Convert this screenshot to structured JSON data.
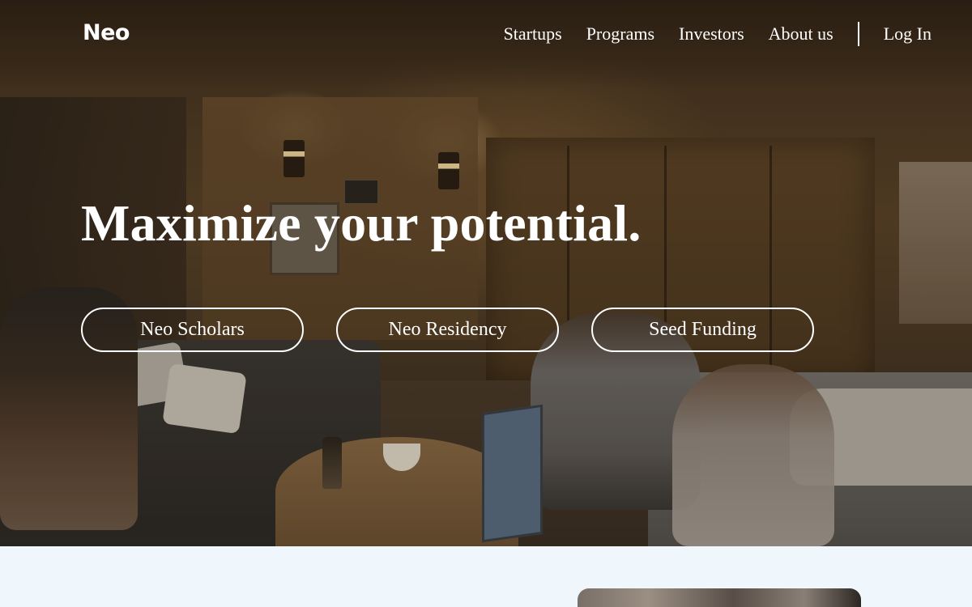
{
  "brand": {
    "logo_text": "Neo"
  },
  "nav": {
    "items": [
      {
        "label": "Startups"
      },
      {
        "label": "Programs"
      },
      {
        "label": "Investors"
      },
      {
        "label": "About us"
      }
    ],
    "login_label": "Log In"
  },
  "hero": {
    "headline": "Maximize your potential.",
    "buttons": [
      {
        "label": "Neo Scholars"
      },
      {
        "label": "Neo Residency"
      },
      {
        "label": "Seed Funding"
      }
    ]
  },
  "colors": {
    "text_on_hero": "#ffffff",
    "section_background": "#eff7fd"
  }
}
